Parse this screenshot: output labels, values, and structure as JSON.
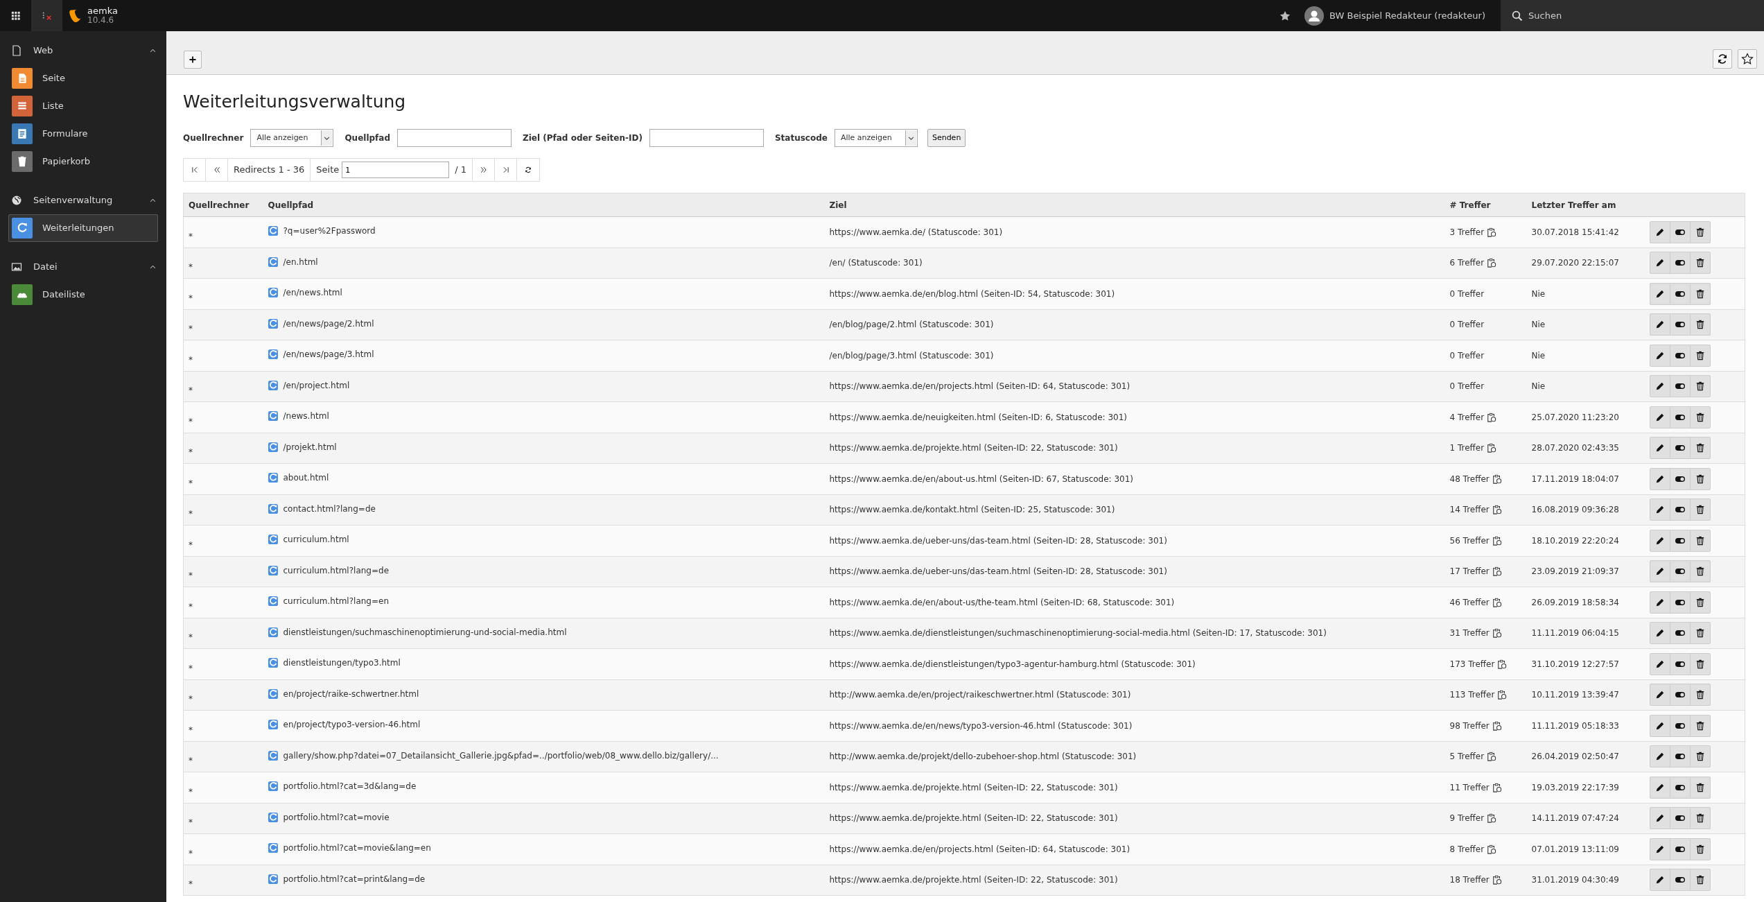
{
  "topbar": {
    "site_name": "aemka",
    "version": "10.4.6",
    "user": "BW Beispiel Redakteur (redakteur)",
    "search": "Suchen"
  },
  "sidebar": [
    {
      "label": "Web",
      "expanded": true,
      "items": [
        {
          "label": "Seite",
          "color": "#f08a33",
          "selected": false
        },
        {
          "label": "Liste",
          "color": "#d2643a",
          "selected": false
        },
        {
          "label": "Formulare",
          "color": "#3a78b3",
          "selected": false
        },
        {
          "label": "Papierkorb",
          "color": "#6b6b6b",
          "selected": false
        }
      ]
    },
    {
      "label": "Seitenverwaltung",
      "expanded": true,
      "items": [
        {
          "label": "Weiterleitungen",
          "color": "#4a90e2",
          "selected": true
        }
      ]
    },
    {
      "label": "Datei",
      "expanded": true,
      "items": [
        {
          "label": "Dateiliste",
          "color": "#4b8a38",
          "selected": false
        }
      ]
    }
  ],
  "title": "Weiterleitungsverwaltung",
  "filters": [
    {
      "kind": "select",
      "label": "Quellrechner",
      "value": "Alle anzeigen"
    },
    {
      "kind": "input",
      "label": "Quellpfad"
    },
    {
      "kind": "input",
      "label": "Ziel (Pfad oder Seiten-ID)"
    },
    {
      "kind": "select",
      "label": "Statuscode",
      "value": "Alle anzeigen"
    }
  ],
  "submit": "Senden",
  "pagination": {
    "range": "Redirects 1 - 36",
    "page_label": "Seite",
    "page": "1",
    "total": "/ 1"
  },
  "table": {
    "columns": [
      "Quellrechner",
      "Quellpfad",
      "Ziel",
      "# Treffer",
      "Letzter Treffer am"
    ],
    "rows": [
      {
        "host": "*",
        "source": "?q=user%2Fpassword",
        "target": "https://www.aemka.de/ (Statuscode: 301)",
        "hits": "3 Treffer",
        "reset": true,
        "last_hit": "30.07.2018 15:41:42"
      },
      {
        "host": "*",
        "source": "/en.html",
        "target": "/en/ (Statuscode: 301)",
        "hits": "6 Treffer",
        "reset": true,
        "last_hit": "29.07.2020 22:15:07"
      },
      {
        "host": "*",
        "source": "/en/news.html",
        "target": "https://www.aemka.de/en/blog.html (Seiten-ID: 54, Statuscode: 301)",
        "hits": "0 Treffer",
        "reset": false,
        "last_hit": "Nie"
      },
      {
        "host": "*",
        "source": "/en/news/page/2.html",
        "target": "/en/blog/page/2.html (Statuscode: 301)",
        "hits": "0 Treffer",
        "reset": false,
        "last_hit": "Nie"
      },
      {
        "host": "*",
        "source": "/en/news/page/3.html",
        "target": "/en/blog/page/3.html (Statuscode: 301)",
        "hits": "0 Treffer",
        "reset": false,
        "last_hit": "Nie"
      },
      {
        "host": "*",
        "source": "/en/project.html",
        "target": "https://www.aemka.de/en/projects.html (Seiten-ID: 64, Statuscode: 301)",
        "hits": "0 Treffer",
        "reset": false,
        "last_hit": "Nie"
      },
      {
        "host": "*",
        "source": "/news.html",
        "target": "https://www.aemka.de/neuigkeiten.html (Seiten-ID: 6, Statuscode: 301)",
        "hits": "4 Treffer",
        "reset": true,
        "last_hit": "25.07.2020 11:23:20"
      },
      {
        "host": "*",
        "source": "/projekt.html",
        "target": "https://www.aemka.de/projekte.html (Seiten-ID: 22, Statuscode: 301)",
        "hits": "1 Treffer",
        "reset": true,
        "last_hit": "28.07.2020 02:43:35"
      },
      {
        "host": "*",
        "source": "about.html",
        "target": "https://www.aemka.de/en/about-us.html (Seiten-ID: 67, Statuscode: 301)",
        "hits": "48 Treffer",
        "reset": true,
        "last_hit": "17.11.2019 18:04:07"
      },
      {
        "host": "*",
        "source": "contact.html?lang=de",
        "target": "https://www.aemka.de/kontakt.html (Seiten-ID: 25, Statuscode: 301)",
        "hits": "14 Treffer",
        "reset": true,
        "last_hit": "16.08.2019 09:36:28"
      },
      {
        "host": "*",
        "source": "curriculum.html",
        "target": "https://www.aemka.de/ueber-uns/das-team.html (Seiten-ID: 28, Statuscode: 301)",
        "hits": "56 Treffer",
        "reset": true,
        "last_hit": "18.10.2019 22:20:24"
      },
      {
        "host": "*",
        "source": "curriculum.html?lang=de",
        "target": "https://www.aemka.de/ueber-uns/das-team.html (Seiten-ID: 28, Statuscode: 301)",
        "hits": "17 Treffer",
        "reset": true,
        "last_hit": "23.09.2019 21:09:37"
      },
      {
        "host": "*",
        "source": "curriculum.html?lang=en",
        "target": "https://www.aemka.de/en/about-us/the-team.html (Seiten-ID: 68, Statuscode: 301)",
        "hits": "46 Treffer",
        "reset": true,
        "last_hit": "26.09.2019 18:58:34"
      },
      {
        "host": "*",
        "source": "dienstleistungen/suchmaschinenoptimierung-und-social-media.html",
        "target": "https://www.aemka.de/dienstleistungen/suchmaschinenoptimierung-social-media.html (Seiten-ID: 17, Statuscode: 301)",
        "hits": "31 Treffer",
        "reset": true,
        "last_hit": "11.11.2019 06:04:15"
      },
      {
        "host": "*",
        "source": "dienstleistungen/typo3.html",
        "target": "https://www.aemka.de/dienstleistungen/typo3-agentur-hamburg.html (Statuscode: 301)",
        "hits": "173 Treffer",
        "reset": true,
        "last_hit": "31.10.2019 12:27:57"
      },
      {
        "host": "*",
        "source": "en/project/raike-schwertner.html",
        "target": "http://www.aemka.de/en/project/raikeschwertner.html (Statuscode: 301)",
        "hits": "113 Treffer",
        "reset": true,
        "last_hit": "10.11.2019 13:39:47"
      },
      {
        "host": "*",
        "source": "en/project/typo3-version-46.html",
        "target": "https://www.aemka.de/en/news/typo3-version-46.html (Statuscode: 301)",
        "hits": "98 Treffer",
        "reset": true,
        "last_hit": "11.11.2019 05:18:33"
      },
      {
        "host": "*",
        "source": "gallery/show.php?datei=07_Detailansicht_Gallerie.jpg&pfad=../portfolio/web/08_www.dello.biz/gallery/...",
        "target": "http://www.aemka.de/projekt/dello-zubehoer-shop.html (Statuscode: 301)",
        "hits": "5 Treffer",
        "reset": true,
        "last_hit": "26.04.2019 02:50:47"
      },
      {
        "host": "*",
        "source": "portfolio.html?cat=3d&lang=de",
        "target": "https://www.aemka.de/projekte.html (Seiten-ID: 22, Statuscode: 301)",
        "hits": "11 Treffer",
        "reset": true,
        "last_hit": "19.03.2019 22:17:39"
      },
      {
        "host": "*",
        "source": "portfolio.html?cat=movie",
        "target": "https://www.aemka.de/projekte.html (Seiten-ID: 22, Statuscode: 301)",
        "hits": "9 Treffer",
        "reset": true,
        "last_hit": "14.11.2019 07:47:24"
      },
      {
        "host": "*",
        "source": "portfolio.html?cat=movie&lang=en",
        "target": "https://www.aemka.de/en/projects.html (Seiten-ID: 64, Statuscode: 301)",
        "hits": "8 Treffer",
        "reset": true,
        "last_hit": "07.01.2019 13:11:09"
      },
      {
        "host": "*",
        "source": "portfolio.html?cat=print&lang=de",
        "target": "https://www.aemka.de/projekte.html (Seiten-ID: 22, Statuscode: 301)",
        "hits": "18 Treffer",
        "reset": true,
        "last_hit": "31.01.2019 04:30:49"
      }
    ]
  }
}
